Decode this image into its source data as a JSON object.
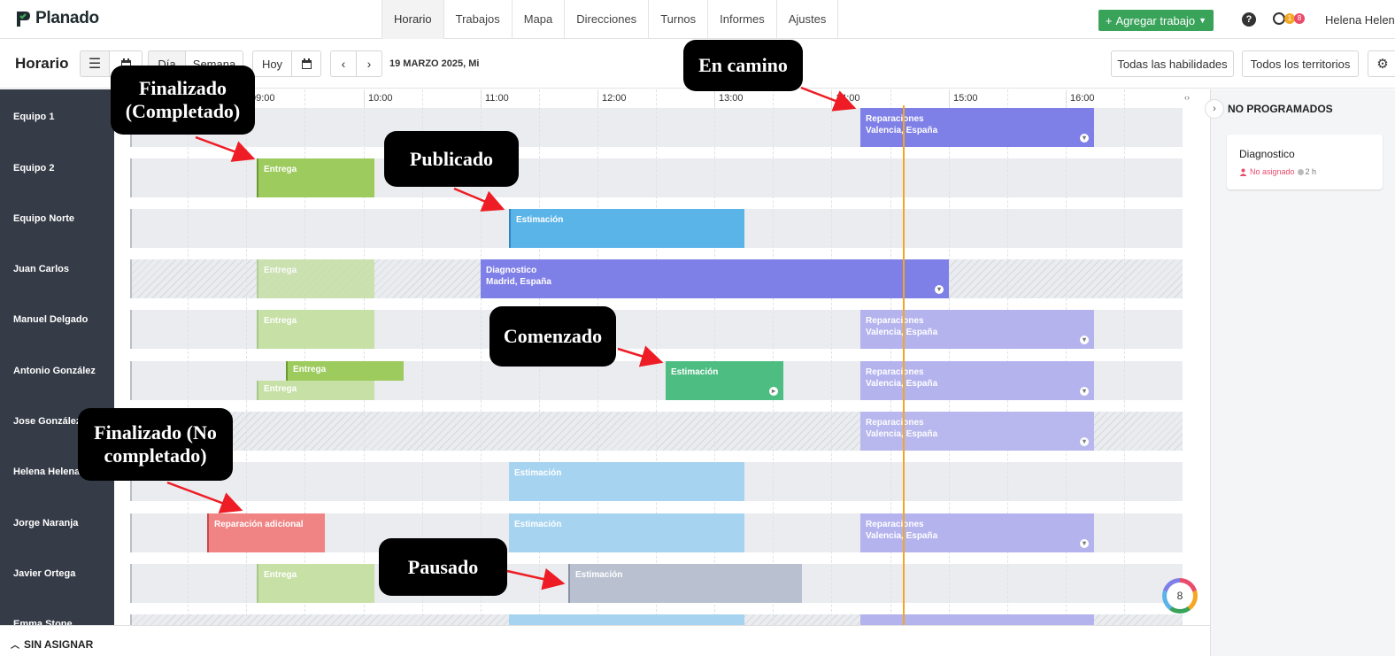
{
  "app": {
    "name": "Planado"
  },
  "nav": {
    "tabs": [
      "Horario",
      "Trabajos",
      "Mapa",
      "Direcciones",
      "Turnos",
      "Informes",
      "Ajustes"
    ]
  },
  "header": {
    "add_job": "Agregar trabajo",
    "help": "?",
    "notif_counts": [
      "1",
      "8"
    ],
    "user": "Helena Helen"
  },
  "toolbar": {
    "title": "Horario",
    "day": "Día",
    "week": "Semana",
    "today": "Hoy",
    "date": "19 MARZO 2025, Mi",
    "skills": "Todas las habilidades",
    "territories": "Todos los territorios"
  },
  "timeline": {
    "hours": [
      "09:00",
      "10:00",
      "11:00",
      "12:00",
      "13:00",
      "14:00",
      "15:00",
      "16:00"
    ]
  },
  "rows": [
    "Equipo 1",
    "Equipo 2",
    "Equipo Norte",
    "Juan Carlos",
    "Manuel Delgado",
    "Antonio González",
    "Jose González",
    "Helena Helena",
    "Jorge Naranja",
    "Javier Ortega",
    "Emma Stone"
  ],
  "jobs": {
    "reparaciones": "Reparaciones",
    "valencia": "Valencia, España",
    "entrega": "Entrega",
    "estimacion": "Estimación",
    "diagnostico": "Diagnostico",
    "madrid": "Madrid, España",
    "reparacion_adicional": "Reparación adicional"
  },
  "unscheduled": {
    "title": "NO PROGRAMADOS",
    "card": {
      "title": "Diagnostico",
      "assignee": "No asignado",
      "duration": "2 h"
    }
  },
  "bottom": {
    "label": "SIN ASIGNAR"
  },
  "counter": "8",
  "callouts": {
    "en_camino": "En camino",
    "finalizado_completado": "Finalizado (Completado)",
    "publicado": "Publicado",
    "comenzado": "Comenzado",
    "finalizado_no_completado": "Finalizado (No completado)",
    "pausado": "Pausado"
  },
  "colors": {
    "accent_green": "#3aa35a",
    "now_line": "#f2a623",
    "sidebar": "#353b47",
    "job_purple": "#7f7fe8",
    "job_green": "#9dcb5d",
    "job_blue": "#5ab4e8",
    "job_teal": "#4dbd82",
    "job_red": "#f08484",
    "job_gray": "#b9c1d0"
  }
}
